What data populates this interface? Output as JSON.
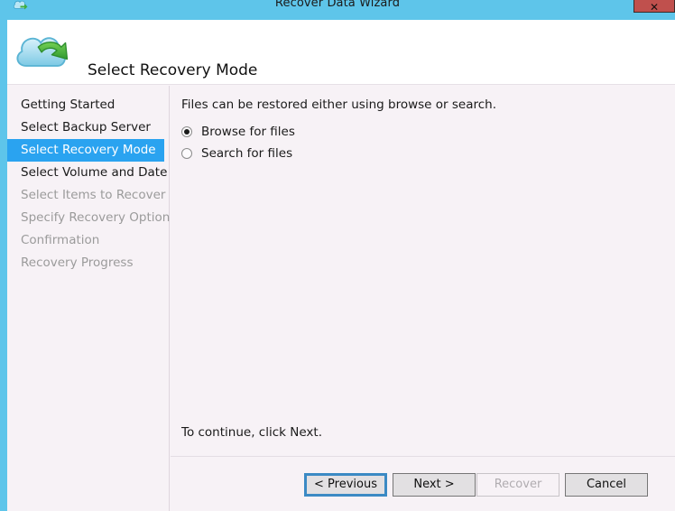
{
  "window": {
    "title": "Recover Data Wizard",
    "title_icon": "cloud-recover-icon",
    "close_label": "✕"
  },
  "header": {
    "icon": "cloud-recover-icon",
    "title": "Select Recovery Mode"
  },
  "sidebar": {
    "items": [
      {
        "label": "Getting Started",
        "state": "enabled"
      },
      {
        "label": "Select Backup Server",
        "state": "enabled"
      },
      {
        "label": "Select Recovery Mode",
        "state": "selected"
      },
      {
        "label": "Select Volume and Date",
        "state": "enabled"
      },
      {
        "label": "Select Items to Recover",
        "state": "disabled"
      },
      {
        "label": "Specify Recovery Options",
        "state": "disabled"
      },
      {
        "label": "Confirmation",
        "state": "disabled"
      },
      {
        "label": "Recovery Progress",
        "state": "disabled"
      }
    ]
  },
  "content": {
    "intro": "Files can be restored either using browse or search.",
    "options": [
      {
        "label": "Browse for files",
        "selected": true
      },
      {
        "label": "Search for files",
        "selected": false
      }
    ],
    "footnote": "To continue, click Next."
  },
  "buttons": {
    "previous": "< Previous",
    "next": "Next >",
    "recover": "Recover",
    "cancel": "Cancel"
  },
  "colors": {
    "titlebar": "#5ec5ea",
    "accent_strip": "#5ec5ea",
    "selection": "#2aa3f0",
    "page_background": "#f7f2f6",
    "header_background": "#ffffff",
    "close_button": "#c0504d"
  }
}
